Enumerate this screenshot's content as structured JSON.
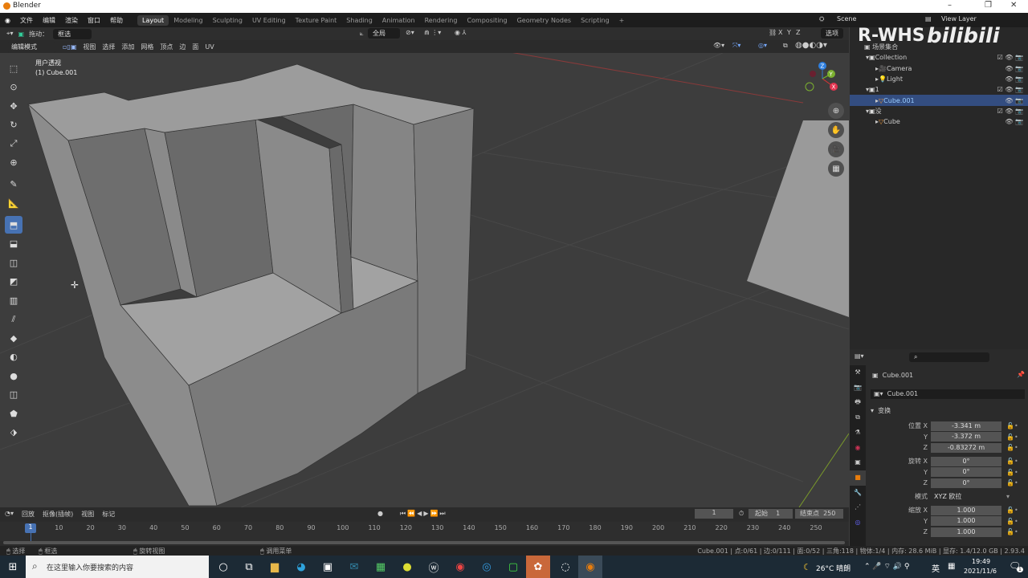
{
  "window": {
    "title": "Blender",
    "minimize": "–",
    "maximize": "❐",
    "close": "✕"
  },
  "menu": [
    "文件",
    "编辑",
    "渲染",
    "窗口",
    "帮助"
  ],
  "workspaces": [
    "Layout",
    "Modeling",
    "Sculpting",
    "UV Editing",
    "Texture Paint",
    "Shading",
    "Animation",
    "Rendering",
    "Compositing",
    "Geometry Nodes",
    "Scripting",
    "+"
  ],
  "active_workspace": "Layout",
  "scene": {
    "label": "Scene",
    "view_layer": "View Layer"
  },
  "tool_header": {
    "drag_label": "拖动：",
    "drag_value": "框选",
    "transform_orientation": "全局",
    "options": "选项",
    "axes": [
      "X",
      "Y",
      "Z"
    ]
  },
  "viewport_header": {
    "mode": "编辑模式",
    "menus": [
      "视图",
      "选择",
      "添加",
      "网格",
      "顶点",
      "边",
      "面",
      "UV"
    ]
  },
  "viewport": {
    "view_name": "用户透视",
    "object_info": "(1) Cube.001",
    "gizmo_axes": [
      "X",
      "Y",
      "Z"
    ]
  },
  "toolbar": [
    "select-box",
    "cursor",
    "move",
    "rotate",
    "scale",
    "transform",
    "annotate",
    "measure",
    "add-cube",
    "extrude",
    "inset",
    "bevel",
    "loop-cut",
    "knife",
    "poly-build",
    "spin",
    "smooth",
    "shrink-fatten",
    "shear",
    "rip"
  ],
  "watermark": {
    "text": "R-WHS",
    "brand": "bilibili"
  },
  "outliner": {
    "root": "场景集合",
    "items": [
      {
        "label": "Collection",
        "depth": 1,
        "type": "collection",
        "check": true
      },
      {
        "label": "Camera",
        "depth": 2,
        "type": "camera"
      },
      {
        "label": "Light",
        "depth": 2,
        "type": "light"
      },
      {
        "label": "1",
        "depth": 1,
        "type": "collection",
        "check": true
      },
      {
        "label": "Cube.001",
        "depth": 2,
        "type": "mesh",
        "selected": true
      },
      {
        "label": "没",
        "depth": 1,
        "type": "collection",
        "check": true
      },
      {
        "label": "Cube",
        "depth": 2,
        "type": "mesh"
      }
    ]
  },
  "properties": {
    "object_name": "Cube.001",
    "datablock": "Cube.001",
    "panel": "变换",
    "location": {
      "label": "位置",
      "x": "-3.341 m",
      "y": "-3.372 m",
      "z": "-0.83272 m"
    },
    "rotation": {
      "label": "旋转",
      "x": "0°",
      "y": "0°",
      "z": "0°"
    },
    "mode": {
      "label": "模式",
      "value": "XYZ 欧拉"
    },
    "scale": {
      "label": "缩放",
      "x": "1.000",
      "y": "1.000",
      "z": "1.000"
    },
    "axis": {
      "x": "X",
      "y": "Y",
      "z": "Z"
    }
  },
  "timeline": {
    "menus": [
      "回放",
      "抠像(插帧)",
      "视图",
      "标记"
    ],
    "current_frame": "1",
    "start_label": "起始",
    "start": "1",
    "end_label": "结束点",
    "end": "250",
    "ticks": [
      10,
      20,
      30,
      40,
      50,
      60,
      70,
      80,
      90,
      100,
      110,
      120,
      130,
      140,
      150,
      160,
      170,
      180,
      190,
      200,
      210,
      220,
      230,
      240,
      250
    ],
    "playhead": "1"
  },
  "statusbar": {
    "select": "选择",
    "box_select": "框选",
    "rotate_view": "旋转视图",
    "context_menu": "调用菜单",
    "stats": "Cube.001 | 点:0/61 | 边:0/111 | 面:0/52 | 三角:118 | 物体:1/4 | 内存: 28.6 MiB | 显存: 1.4/12.0 GB | 2.93.4"
  },
  "taskbar": {
    "search_placeholder": "在这里输入你要搜索的内容",
    "weather": "26°C 晴朗",
    "ime": "英",
    "time": "19:49",
    "date": "2021/11/6",
    "notifications": "1"
  },
  "colors": {
    "accent": "#4772b3",
    "selected_row": "#334d80",
    "header": "#2b2b2b",
    "viewport": "#3d3d3d",
    "blender_orange": "#e87d0d"
  }
}
